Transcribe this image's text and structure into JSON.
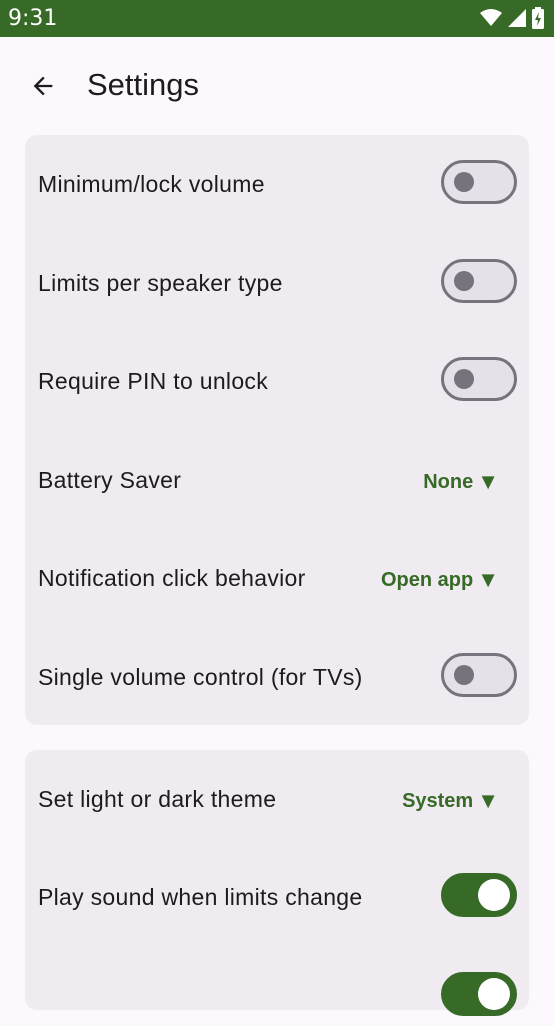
{
  "status_bar": {
    "time": "9:31",
    "icons": [
      "wifi-icon",
      "signal-icon",
      "battery-icon"
    ]
  },
  "app_bar": {
    "title": "Settings",
    "back_icon": "arrow-back-icon"
  },
  "colors": {
    "primary": "#376a27",
    "background": "#fdf8fd",
    "card": "#efebf0",
    "text": "#1c1b1f",
    "switch_off_outline": "#77727c"
  },
  "card1": {
    "rows": [
      {
        "label": "Minimum/lock volume",
        "type": "switch",
        "on": false
      },
      {
        "label": "Limits per speaker type",
        "type": "switch",
        "on": false
      },
      {
        "label": "Require PIN to unlock",
        "type": "switch",
        "on": false
      },
      {
        "label": "Battery Saver",
        "type": "dropdown",
        "value": "None"
      },
      {
        "label": "Notification click behavior",
        "type": "dropdown",
        "value": "Open app"
      },
      {
        "label": "Single volume control (for TVs)",
        "type": "switch",
        "on": false
      }
    ]
  },
  "card2": {
    "rows": [
      {
        "label": "Set light or dark theme",
        "type": "dropdown",
        "value": "System"
      },
      {
        "label": "Play sound when limits change",
        "type": "switch",
        "on": true
      },
      {
        "label": "",
        "type": "switch",
        "on": true
      }
    ]
  },
  "dropdown_arrow": "▼"
}
